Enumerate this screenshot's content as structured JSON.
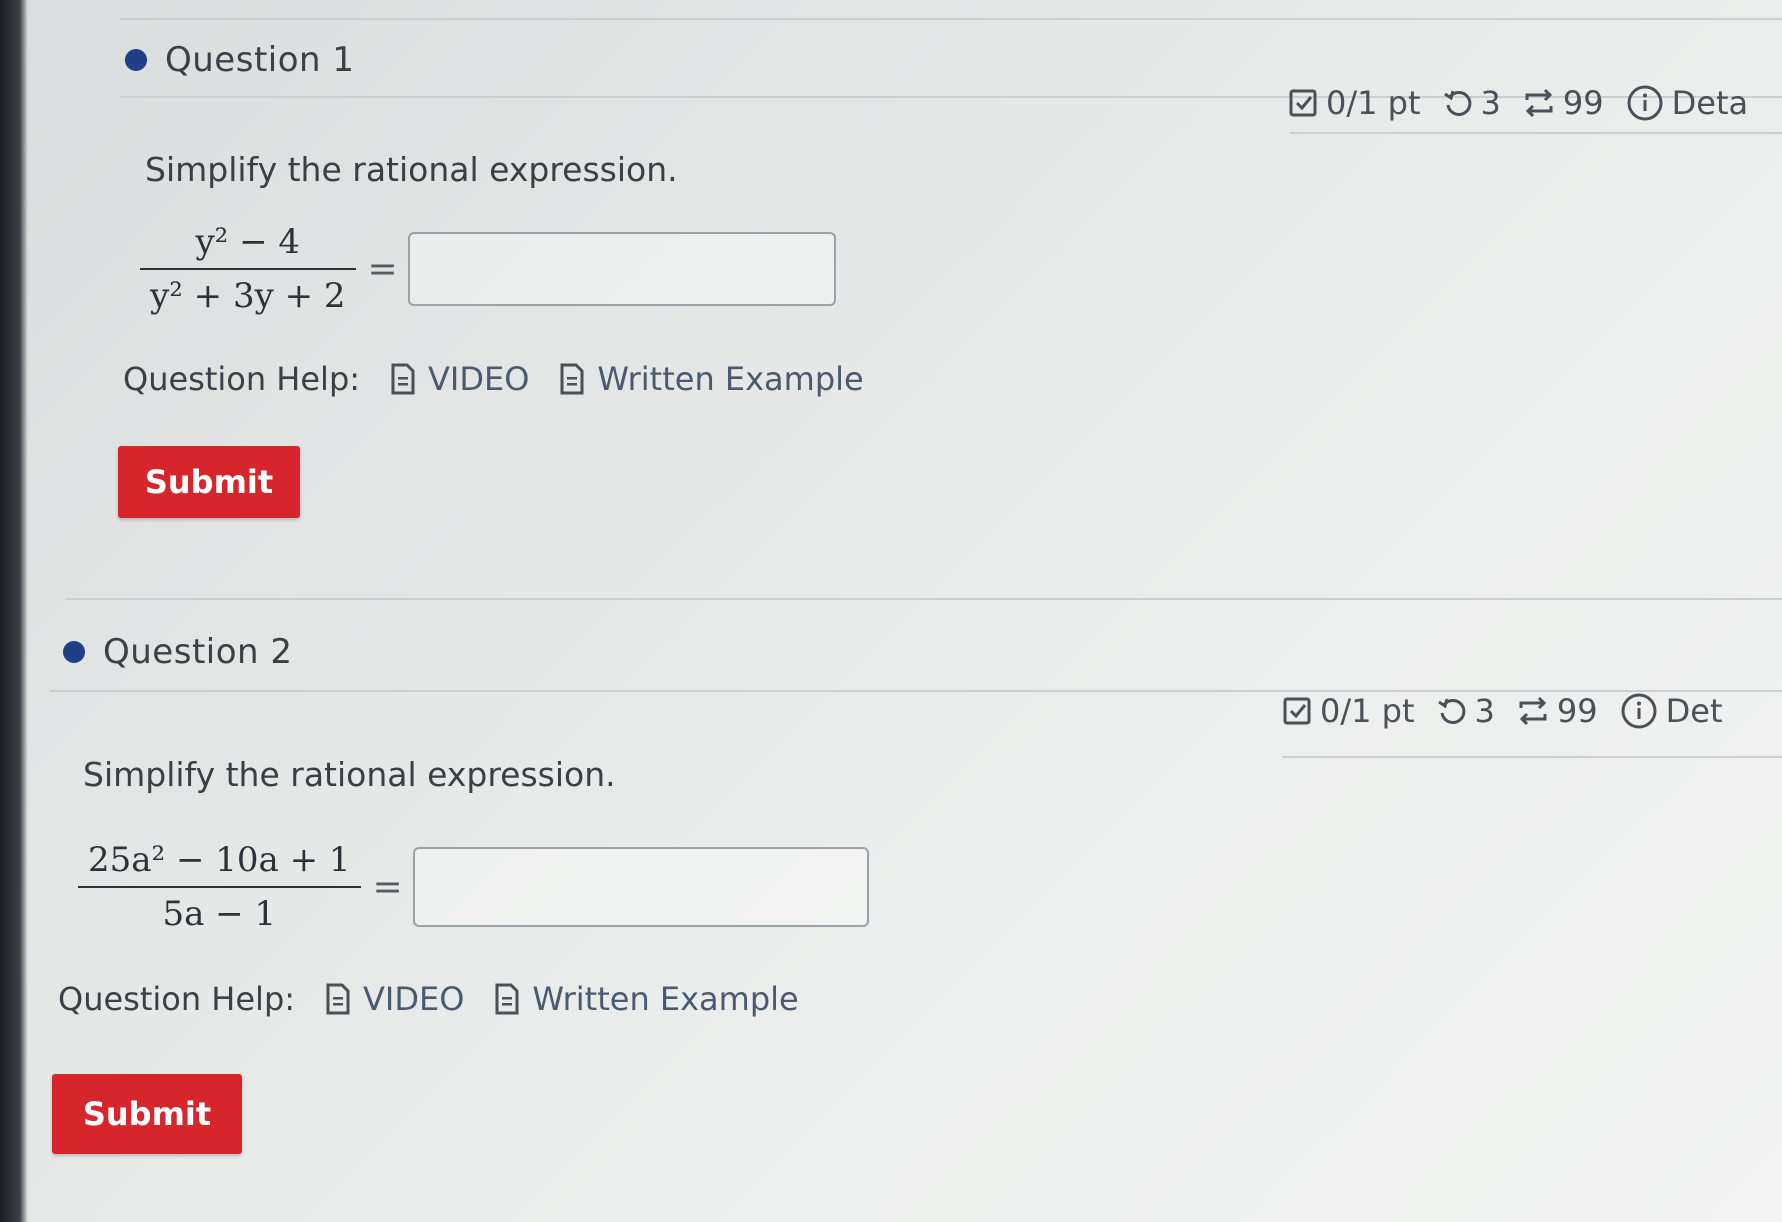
{
  "questions": [
    {
      "title": "Question 1",
      "meta": {
        "points": "0/1 pt",
        "retries": "3",
        "attempts": "99",
        "details_label": "Deta"
      },
      "prompt": "Simplify the rational expression.",
      "expression": {
        "numerator": "y² − 4",
        "denominator": "y² + 3y + 2",
        "equals": "="
      },
      "answer_value": "",
      "help": {
        "label": "Question Help:",
        "video": "VIDEO",
        "written_example": "Written Example"
      },
      "submit_label": "Submit"
    },
    {
      "title": "Question 2",
      "meta": {
        "points": "0/1 pt",
        "retries": "3",
        "attempts": "99",
        "details_label": "Det"
      },
      "prompt": "Simplify the rational expression.",
      "expression": {
        "numerator": "25a² − 10a + 1",
        "denominator": "5a − 1",
        "equals": "="
      },
      "answer_value": "",
      "help": {
        "label": "Question Help:",
        "video": "VIDEO",
        "written_example": "Written Example"
      },
      "submit_label": "Submit"
    }
  ],
  "colors": {
    "bullet": "#1f3f8a",
    "submit": "#d7262b",
    "link": "#4a5a6e"
  },
  "icons": {
    "points": "checkbox-icon",
    "retries": "retry-icon",
    "attempts": "repeat-icon",
    "details": "info-icon",
    "help_links": "document-icon"
  }
}
